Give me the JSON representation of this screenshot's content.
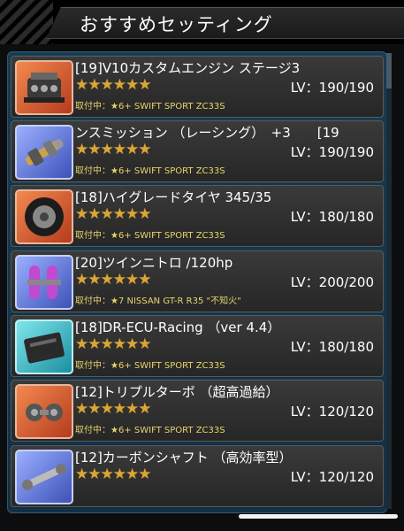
{
  "header": {
    "title": "おすすめセッティング"
  },
  "items": [
    {
      "name": "[19]V10カスタムエンジン ステージ3",
      "stars": "★★★★★★",
      "lv": "LV：190/190",
      "equip": "取付中：★6+ SWIFT SPORT ZC33S",
      "icon": "engine-icon",
      "theme": "red"
    },
    {
      "name": "ンスミッション （レーシング）　+3　　[19",
      "stars": "★★★★★★",
      "lv": "LV：190/190",
      "equip": "取付中：★6+ SWIFT SPORT ZC33S",
      "icon": "transmission-icon",
      "theme": "blue"
    },
    {
      "name": "[18]ハイグレードタイヤ 345/35",
      "stars": "★★★★★★",
      "lv": "LV：180/180",
      "equip": "取付中：★6+ SWIFT SPORT ZC33S",
      "icon": "tire-icon",
      "theme": "red"
    },
    {
      "name": "[20]ツインニトロ /120hp",
      "stars": "★★★★★★",
      "lv": "LV：200/200",
      "equip": "取付中：★7 NISSAN GT-R R35 \"不知火\"",
      "icon": "nitro-icon",
      "theme": "blue"
    },
    {
      "name": "[18]DR-ECU-Racing （ver 4.4）",
      "stars": "★★★★★★",
      "lv": "LV：180/180",
      "equip": "取付中：★6+ SWIFT SPORT ZC33S",
      "icon": "ecu-icon",
      "theme": "teal"
    },
    {
      "name": "[12]トリプルターボ （超高過給）",
      "stars": "★★★★★★",
      "lv": "LV：120/120",
      "equip": "取付中：★6+ SWIFT SPORT ZC33S",
      "icon": "turbo-icon",
      "theme": "red"
    },
    {
      "name": "[12]カーボンシャフト （高効率型）",
      "stars": "★★★★★★",
      "lv": "LV：120/120",
      "equip": "",
      "icon": "shaft-icon",
      "theme": "blue"
    }
  ]
}
